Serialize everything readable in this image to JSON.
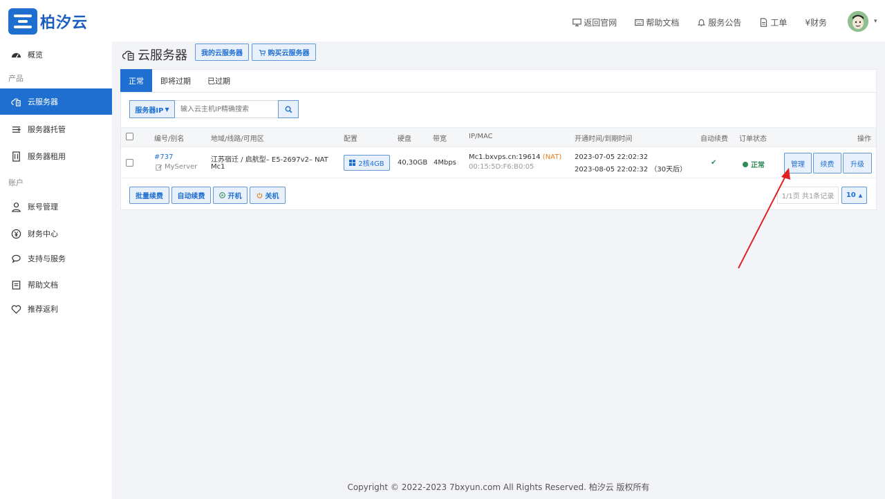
{
  "brand": {
    "name": "柏汐云"
  },
  "topnav": {
    "items": [
      {
        "label": "返回官网",
        "icon": "monitor-icon"
      },
      {
        "label": "帮助文档",
        "icon": "keyboard-icon"
      },
      {
        "label": "服务公告",
        "icon": "bell-icon"
      },
      {
        "label": "工单",
        "icon": "document-icon"
      },
      {
        "label": "¥财务",
        "icon": "yen-icon"
      }
    ],
    "avatar_caret": "▾"
  },
  "sidebar": {
    "sections": {
      "product": "产品",
      "account": "账户"
    },
    "items": [
      {
        "label": "概览",
        "icon": "dashboard-icon"
      },
      {
        "label": "云服务器",
        "icon": "cloud-server-icon"
      },
      {
        "label": "服务器托管",
        "icon": "hosting-icon"
      },
      {
        "label": "服务器租用",
        "icon": "rental-icon"
      },
      {
        "label": "账号管理",
        "icon": "user-icon"
      },
      {
        "label": "财务中心",
        "icon": "yen-circle-icon"
      },
      {
        "label": "支持与服务",
        "icon": "chat-icon"
      },
      {
        "label": "帮助文档",
        "icon": "doc-icon"
      },
      {
        "label": "推荐返利",
        "icon": "heart-icon"
      }
    ]
  },
  "page": {
    "title": "云服务器",
    "my_servers_btn": "我的云服务器",
    "buy_btn": "购买云服务器"
  },
  "tabs": [
    "正常",
    "即将过期",
    "已过期"
  ],
  "search": {
    "filter": "服务器IP",
    "placeholder": "输入云主机IP精确搜索"
  },
  "table": {
    "headers": [
      "编号/别名",
      "地域/线路/可用区",
      "配置",
      "硬盘",
      "带宽",
      "IP/MAC",
      "开通时间/到期时间",
      "自动续费",
      "订单状态",
      "操作"
    ],
    "rows": [
      {
        "id": "#737",
        "alias": "MyServer",
        "region_line1": "江苏宿迁 / 启航型– E5-2697v2– NAT",
        "region_line2": "Mc1",
        "config": "2核4GB",
        "disk": "40,30GB",
        "bandwidth": "4Mbps",
        "host": "Mc1.bxvps.cn:19614",
        "nat": "(NAT)",
        "mac": "00:15:5D:F6:B0:05",
        "open_time": "2023-07-05 22:02:32",
        "expire_time": "2023-08-05 22:02:32",
        "expire_note": "（30天后）",
        "auto_renew": "✔",
        "status": "正常",
        "actions": [
          "管理",
          "续费",
          "升级"
        ]
      }
    ]
  },
  "bulk": {
    "renew": "批量续费",
    "auto": "自动续费",
    "on": "开机",
    "off": "关机"
  },
  "pagination": {
    "info": "1/1页 共1条记录",
    "size": "10"
  },
  "footer": {
    "copyright": "Copyright © 2022-2023 7bxyun.com All Rights Reserved. 柏汐云 版权所有"
  },
  "colors": {
    "primary": "#1f6fd1",
    "status_green": "#2e8b57",
    "nat_orange": "#e67e22",
    "arrow_red": "#e02020"
  }
}
